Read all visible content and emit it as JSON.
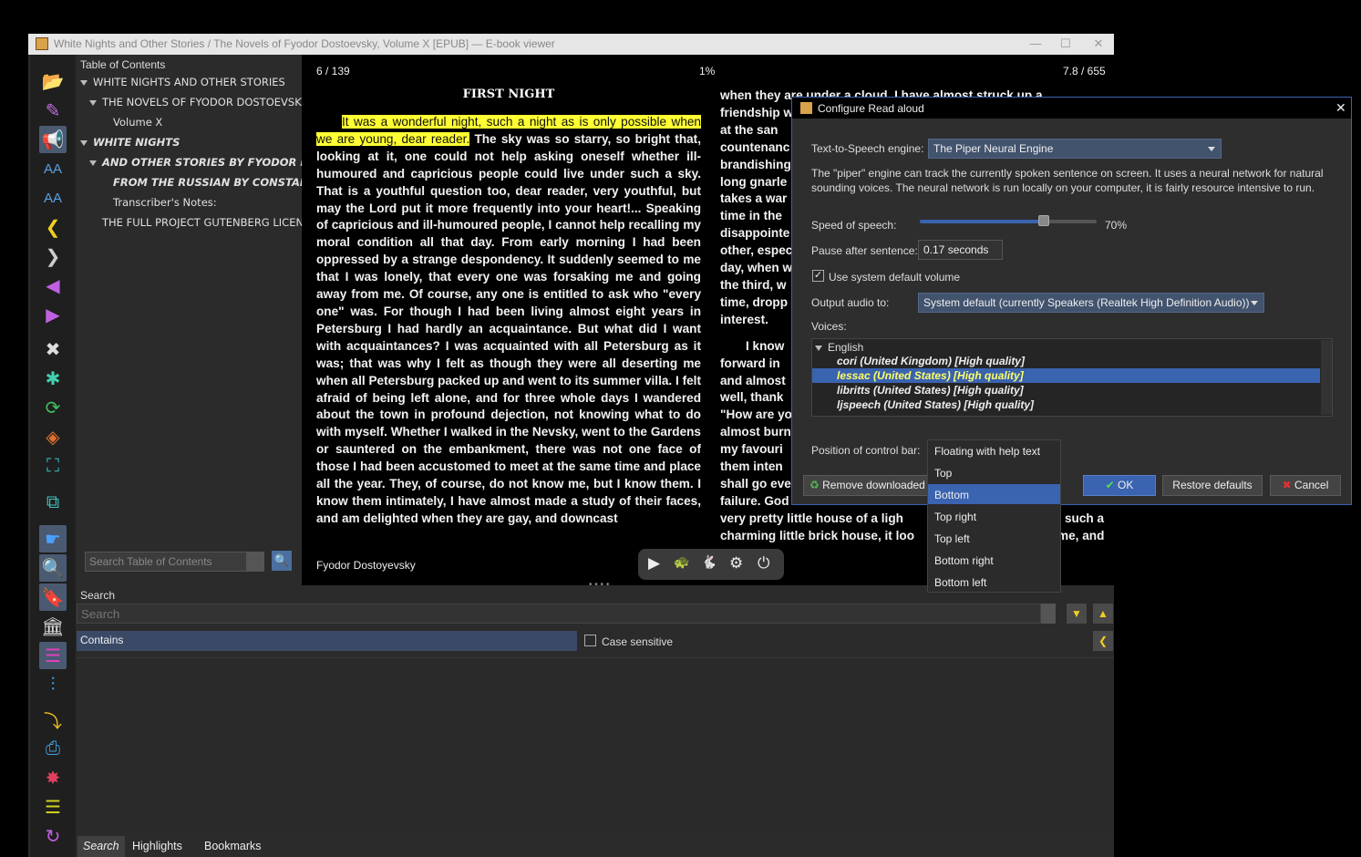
{
  "window": {
    "title": "White Nights and Other Stories / The Novels of Fyodor Dostoevsky, Volume X [EPUB] — E-book viewer",
    "minimize": "—",
    "maximize": "☐",
    "close": "✕"
  },
  "toc": {
    "header": "Table of Contents",
    "items": [
      "WHITE NIGHTS AND OTHER STORIES",
      "THE NOVELS OF FYODOR DOSTOEVSKY",
      "Volume X",
      "WHITE NIGHTS",
      "AND OTHER STORIES BY FYODOR D...",
      "FROM THE RUSSIAN BY CONSTAN...",
      "Transcriber's Notes:",
      "THE FULL PROJECT GUTENBERG LICENSE"
    ],
    "search_placeholder": "Search Table of Contents"
  },
  "book": {
    "page_counter": "6 / 139",
    "percent": "1%",
    "position": "7.8 / 655",
    "chapter_title": "FIRST NIGHT",
    "author_footer": "Fyodor Dostoyevsky",
    "highlighted_text": "It was a wonderful night, such a night as is only possible when we are young, dear reader.",
    "left_col_rest": "The sky was so starry, so bright that, looking at it, one could not help asking oneself whether ill-humoured and capricious people could live under such a sky. That is a youthful question too, dear reader, very youthful, but may the Lord put it more frequently into your heart!... Speaking of capricious and ill-humoured people, I cannot help recalling my moral condition all that day. From early morning I had been oppressed by a strange despondency. It suddenly seemed to me that I was lonely, that every one was forsaking me and going away from me. Of course, any one is entitled to ask who \"every one\" was. For though I had been living almost eight years in Petersburg I had hardly an acquaintance. But what did I want with acquaintances? I was acquainted with all Petersburg as it was; that was why I felt as though they were all deserting me when all Petersburg packed up and went to its summer villa. I felt afraid of being left alone, and for three whole days I wandered about the town in profound dejection, not knowing what to do with myself. Whether I walked in the Nevsky, went to the Gardens or sauntered on the embankment, there was not one face of those I had been accustomed to meet at the same time and place all the year. They, of course, do not know me, but I know them. I know them intimately, I have almost made a study of their faces, and am delighted when they are gay, and downcast",
    "right_col_lines": [
      "when they are under a cloud. I have almost struck up a",
      "friendship w",
      "at the san",
      "countenanc",
      "brandishing",
      "long gnarle",
      "takes a war",
      "time in the",
      "disappointe",
      "other, espec",
      "day, when w",
      "the third, w",
      "time, dropp",
      "interest."
    ],
    "right_col_lines2": [
      "I know",
      "forward in",
      "and almost",
      "well, thank",
      "\"How are yo",
      "almost burn",
      "my favouri",
      "them inten",
      "shall go eve",
      "failure. God",
      "very pretty little house of a ligh",
      "charming little brick house, it loo"
    ],
    "right_tail_1": "such a",
    "right_tail_2": "me, and",
    "controls": [
      "▶",
      "🐢",
      "🐇",
      "⚙",
      "⏻"
    ]
  },
  "search": {
    "header": "Search",
    "placeholder": "Search",
    "mode": "Contains",
    "case_sensitive_label": "Case sensitive",
    "tabs": [
      "Search",
      "Highlights",
      "Bookmarks"
    ]
  },
  "dialog": {
    "title": "Configure Read aloud",
    "engine_label": "Text-to-Speech engine:",
    "engine_value": "The Piper Neural Engine",
    "description": "The \"piper\" engine can track the currently spoken sentence on screen. It uses a neural network for natural sounding voices. The neural network is run locally on your computer, it is fairly resource intensive to run.",
    "speed_label": "Speed of speech:",
    "speed_value": "70%",
    "speed_fraction": 0.7,
    "pause_label": "Pause after sentence:",
    "pause_value": "0.17 seconds",
    "volume_label": "Use system default volume",
    "volume_checked": true,
    "output_label": "Output audio to:",
    "output_value": "System default (currently Speakers (Realtek High Definition Audio))",
    "voices_label": "Voices:",
    "voice_group": "English",
    "voices": [
      "cori (United Kingdom) [High quality]",
      "lessac (United States) [High quality]",
      "libritts (United States) [High quality]",
      "ljspeech (United States) [High quality]"
    ],
    "selected_voice": "lessac (United States) [High quality]",
    "position_label": "Position of control bar:",
    "position_options": [
      "Floating with help text",
      "Top",
      "Bottom",
      "Top right",
      "Top left",
      "Bottom right",
      "Bottom left"
    ],
    "position_selected": "Bottom",
    "remove_button": "Remove downloaded",
    "ok_button": "OK",
    "restore_button": "Restore defaults",
    "cancel_button": "Cancel",
    "close": "✕"
  },
  "colors": {
    "highlight": "#ffff33",
    "selection": "#3a63b0",
    "voice_selected_text": "#ffff66"
  }
}
